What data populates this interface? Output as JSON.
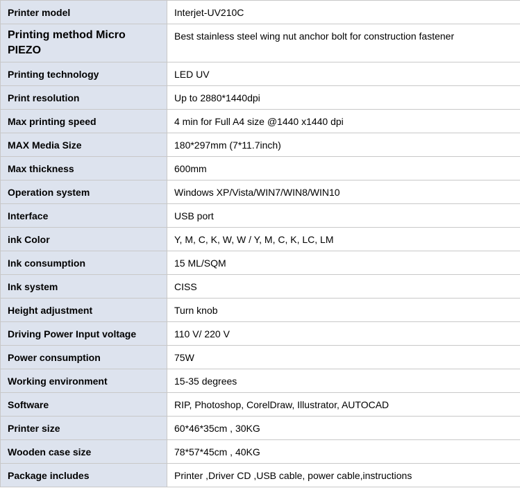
{
  "rows": [
    {
      "label": "Printer model",
      "value": "Interjet-UV210C"
    },
    {
      "label": "Printing method Micro PIEZO",
      "value": "Best stainless steel wing nut anchor bolt for construction fastener"
    },
    {
      "label": "Printing technology",
      "value": "LED UV"
    },
    {
      "label": "Print resolution",
      "value": "Up to 2880*1440dpi"
    },
    {
      "label": "Max printing speed",
      "value": "4 min for Full A4 size @1440 x1440 dpi"
    },
    {
      "label": "MAX Media Size",
      "value": "180*297mm (7*11.7inch)"
    },
    {
      "label": "Max thickness",
      "value": "600mm"
    },
    {
      "label": "Operation system",
      "value": "Windows XP/Vista/WIN7/WIN8/WIN10"
    },
    {
      "label": "Interface",
      "value": "USB port"
    },
    {
      "label": "ink Color",
      "value": "Y, M, C, K, W, W / Y, M, C, K, LC, LM"
    },
    {
      "label": "Ink consumption",
      "value": "15 ML/SQM"
    },
    {
      "label": "Ink system",
      "value": "CISS"
    },
    {
      "label": "Height adjustment",
      "value": "Turn knob"
    },
    {
      "label": "Driving Power Input voltage",
      "value": "110 V/ 220 V"
    },
    {
      "label": "Power consumption",
      "value": "75W"
    },
    {
      "label": "Working environment",
      "value": "15-35 degrees"
    },
    {
      "label": "Software",
      "value": "RIP, Photoshop, CorelDraw, Illustrator, AUTOCAD"
    },
    {
      "label": "Printer size",
      "value": "60*46*35cm , 30KG"
    },
    {
      "label": "Wooden case size",
      "value": "78*57*45cm , 40KG"
    },
    {
      "label": "Package includes",
      "value": "Printer ,Driver CD ,USB cable, power cable,instructions"
    }
  ]
}
